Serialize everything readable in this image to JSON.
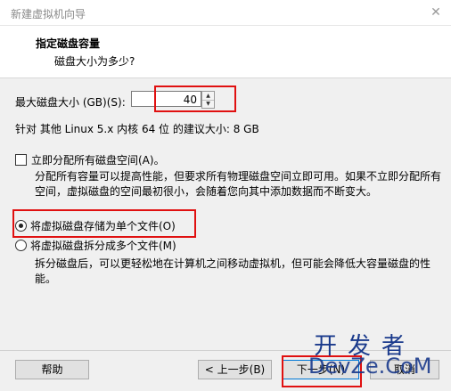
{
  "window": {
    "title": "新建虚拟机向导",
    "close_glyph": "✕"
  },
  "header": {
    "title": "指定磁盘容量",
    "subtitle": "磁盘大小为多少?"
  },
  "disk": {
    "size_label": "最大磁盘大小 (GB)(S):",
    "size_value": "40",
    "recommend": "针对 其他 Linux 5.x 内核 64 位 的建议大小: 8 GB"
  },
  "allocate": {
    "checkbox_label": "立即分配所有磁盘空间(A)。",
    "checked": false,
    "desc": "分配所有容量可以提高性能，但要求所有物理磁盘空间立即可用。如果不立即分配所有空间，虚拟磁盘的空间最初很小，会随着您向其中添加数据而不断变大。"
  },
  "storage": {
    "single_label": "将虚拟磁盘存储为单个文件(O)",
    "split_label": "将虚拟磁盘拆分成多个文件(M)",
    "split_desc": "拆分磁盘后，可以更轻松地在计算机之间移动虚拟机，但可能会降低大容量磁盘的性能。",
    "selected": "single"
  },
  "buttons": {
    "help": "帮助",
    "back": "< 上一步(B)",
    "next": "下一步(N)",
    "cancel": "取消"
  },
  "watermark": {
    "top": "开发者",
    "bottom": "DevZe.CoM"
  },
  "colors": {
    "highlight": "#e01010",
    "watermark": "#1a3a8c",
    "focus": "#0078d7"
  }
}
